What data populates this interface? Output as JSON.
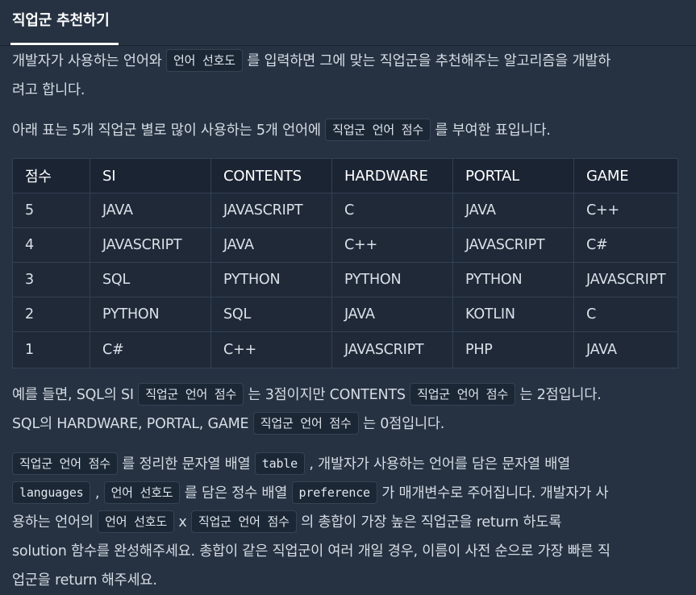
{
  "tab": {
    "title": "직업군 추천하기"
  },
  "para1": {
    "pre": "개발자가 사용하는 언어와 ",
    "code": "언어 선호도",
    "post": " 를 입력하면 그에 맞는 직업군을 추천해주는 알고리즘을 개발하",
    "line2": "려고 합니다."
  },
  "para2": {
    "pre": "아래 표는 5개 직업군 별로 많이 사용하는 5개 언어에 ",
    "code": "직업군 언어 점수",
    "post": " 를 부여한 표입니다."
  },
  "table": {
    "headers": [
      "점수",
      "SI",
      "CONTENTS",
      "HARDWARE",
      "PORTAL",
      "GAME"
    ],
    "rows": [
      [
        "5",
        "JAVA",
        "JAVASCRIPT",
        "C",
        "JAVA",
        "C++"
      ],
      [
        "4",
        "JAVASCRIPT",
        "JAVA",
        "C++",
        "JAVASCRIPT",
        "C#"
      ],
      [
        "3",
        "SQL",
        "PYTHON",
        "PYTHON",
        "PYTHON",
        "JAVASCRIPT"
      ],
      [
        "2",
        "PYTHON",
        "SQL",
        "JAVA",
        "KOTLIN",
        "C"
      ],
      [
        "1",
        "C#",
        "C++",
        "JAVASCRIPT",
        "PHP",
        "JAVA"
      ]
    ]
  },
  "para3": {
    "t1": "예를 들면, SQL의 SI ",
    "code1": "직업군 언어 점수",
    "t2": " 는 3점이지만 CONTENTS ",
    "code2": "직업군 언어 점수",
    "t3": " 는 2점입니다.",
    "t4": "SQL의 HARDWARE, PORTAL, GAME ",
    "code3": "직업군 언어 점수",
    "t5": " 는 0점입니다."
  },
  "para4": {
    "code1": "직업군 언어 점수",
    "t1": " 를 정리한 문자열 배열 ",
    "code2": "table",
    "t2": " , 개발자가 사용하는 언어를 담은 문자열 배열",
    "code3": "languages",
    "t3": " , ",
    "code4": "언어 선호도",
    "t4": " 를 담은 정수 배열 ",
    "code5": "preference",
    "t5": " 가 매개변수로 주어집니다. 개발자가 사",
    "t6": "용하는 언어의 ",
    "code6": "언어 선호도",
    "t7": " x ",
    "code7": "직업군 언어 점수",
    "t8": " 의 총합이 가장 높은 직업군을 return 하도록",
    "t9": "solution 함수를 완성해주세요. 총합이 같은 직업군이 여러 개일 경우, 이름이 사전 순으로 가장 빠른 직",
    "t10": "업군을 return 해주세요."
  }
}
